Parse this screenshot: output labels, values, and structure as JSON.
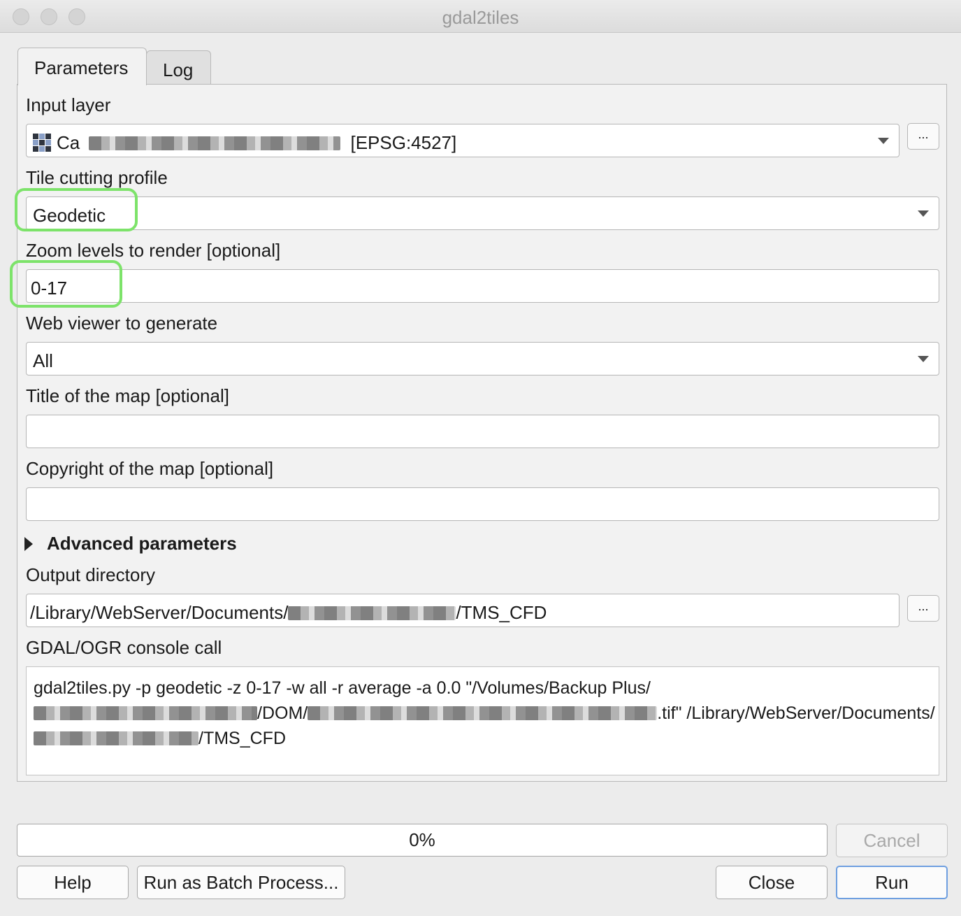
{
  "window": {
    "title": "gdal2tiles"
  },
  "tabs": [
    {
      "label": "Parameters"
    },
    {
      "label": "Log"
    }
  ],
  "params": {
    "input_layer": {
      "label": "Input layer",
      "value_prefix": "Ca",
      "value_suffix": "[EPSG:4527]",
      "browse": "..."
    },
    "tile_profile": {
      "label": "Tile cutting profile",
      "value": "Geodetic"
    },
    "zoom": {
      "label": "Zoom levels to render [optional]",
      "value": "0-17"
    },
    "web_viewer": {
      "label": "Web viewer to generate",
      "value": "All"
    },
    "map_title": {
      "label": "Title of the map [optional]",
      "value": ""
    },
    "copyright": {
      "label": "Copyright of the map [optional]",
      "value": ""
    },
    "advanced": {
      "label": "Advanced parameters"
    },
    "output_dir": {
      "label": "Output directory",
      "value_prefix": "/Library/WebServer/Documents/",
      "value_suffix": "/TMS_CFD",
      "browse": "..."
    },
    "console": {
      "label": "GDAL/OGR console call",
      "line1": "gdal2tiles.py -p geodetic -z 0-17 -w all -r average -a 0.0 \"/Volumes/Backup Plus/",
      "line2_mid": "/DOM/",
      "line2_end": ".tif\" /Library/WebServer/Documents/",
      "line3_end": "/TMS_CFD"
    }
  },
  "progress": {
    "text": "0%",
    "value": 0
  },
  "buttons": {
    "cancel": "Cancel",
    "help": "Help",
    "batch": "Run as Batch Process...",
    "close": "Close",
    "run": "Run"
  }
}
